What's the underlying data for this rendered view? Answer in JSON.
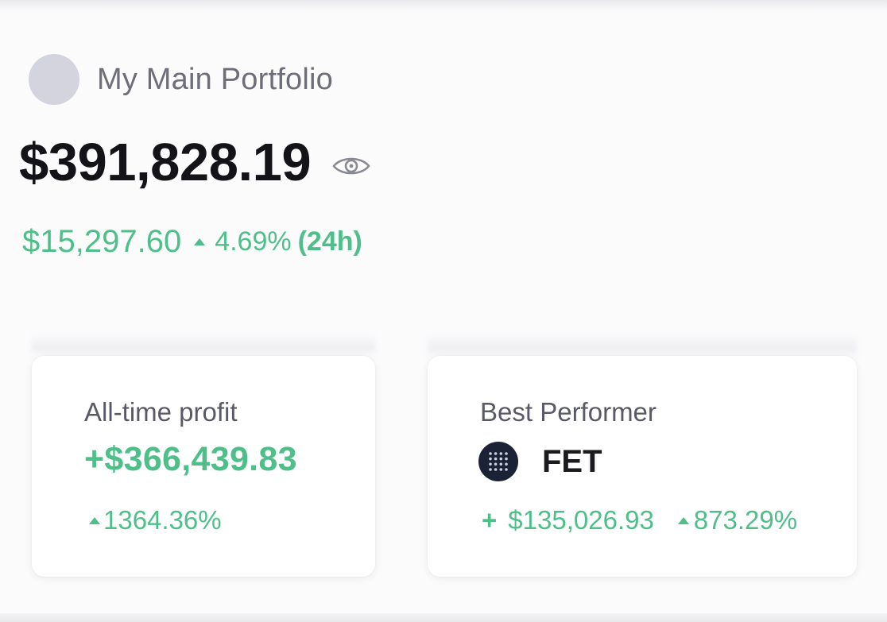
{
  "portfolio": {
    "name": "My Main Portfolio",
    "balance": "$391,828.19",
    "change_amount": "$15,297.60",
    "change_percent": "4.69%",
    "change_period": "(24h)"
  },
  "cards": {
    "all_time_profit": {
      "label": "All-time profit",
      "value": "+$366,439.83",
      "percent": "1364.36%"
    },
    "best_performer": {
      "label": "Best Performer",
      "symbol": "FET",
      "plus": "+",
      "profit": "$135,026.93",
      "percent": "873.29%"
    }
  },
  "icons": {
    "visibility": "eye-icon",
    "asset": "fet-icon",
    "trend": "triangle-up-icon"
  },
  "colors": {
    "positive": "#4fbf8a",
    "text_primary": "#141418",
    "text_secondary": "#6e6e78",
    "avatar": "#d4d4de"
  }
}
